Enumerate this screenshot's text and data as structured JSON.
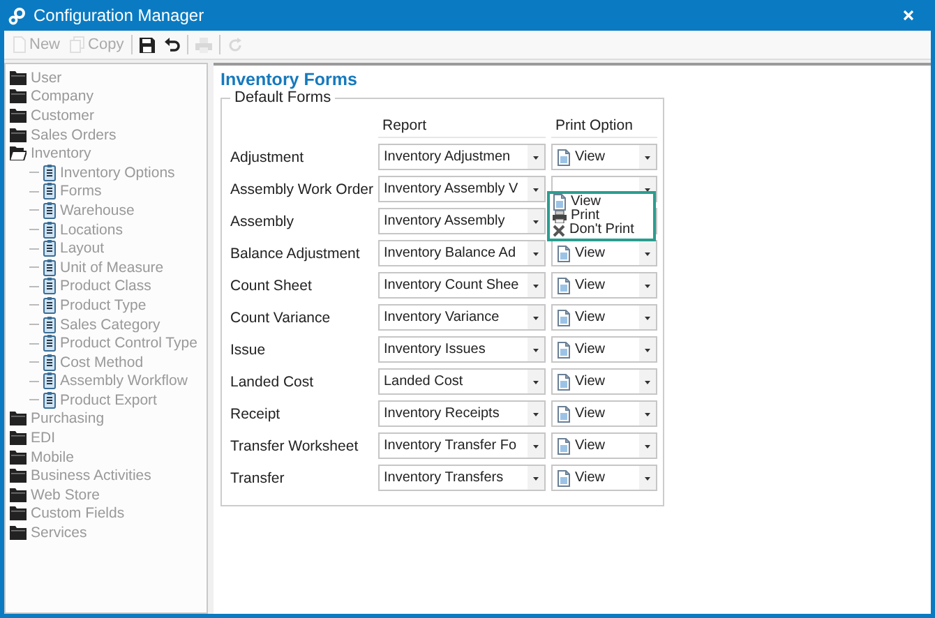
{
  "window": {
    "title": "Configuration Manager"
  },
  "toolbar": [
    {
      "kind": "new",
      "label": "New",
      "disabled": true
    },
    {
      "kind": "copy",
      "label": "Copy",
      "disabled": true
    },
    {
      "kind": "save",
      "disabled": false
    },
    {
      "kind": "undo",
      "disabled": false
    },
    {
      "kind": "print",
      "disabled": true
    },
    {
      "kind": "refresh",
      "disabled": true
    }
  ],
  "sidebar": {
    "items": [
      {
        "label": "User",
        "expanded": false
      },
      {
        "label": "Company",
        "expanded": false
      },
      {
        "label": "Customer",
        "expanded": false
      },
      {
        "label": "Sales Orders",
        "expanded": false
      },
      {
        "label": "Inventory",
        "expanded": true,
        "children": [
          {
            "label": "Inventory Options"
          },
          {
            "label": "Forms"
          },
          {
            "label": "Warehouse"
          },
          {
            "label": "Locations"
          },
          {
            "label": "Layout"
          },
          {
            "label": "Unit of Measure"
          },
          {
            "label": "Product Class"
          },
          {
            "label": "Product Type"
          },
          {
            "label": "Sales Category"
          },
          {
            "label": "Product Control Type"
          },
          {
            "label": "Cost Method"
          },
          {
            "label": "Assembly Workflow"
          },
          {
            "label": "Product Export"
          }
        ]
      },
      {
        "label": "Purchasing",
        "expanded": false
      },
      {
        "label": "EDI",
        "expanded": false
      },
      {
        "label": "Mobile",
        "expanded": false
      },
      {
        "label": "Business Activities",
        "expanded": false
      },
      {
        "label": "Web Store",
        "expanded": false
      },
      {
        "label": "Custom Fields",
        "expanded": false
      },
      {
        "label": "Services",
        "expanded": false
      }
    ]
  },
  "page": {
    "title": "Inventory Forms",
    "group": "Default Forms",
    "columns": [
      "Report",
      "Print Option"
    ],
    "rows": [
      {
        "label": "Adjustment",
        "report": "Inventory Adjustmen",
        "print_option": "View"
      },
      {
        "label": "Assembly Work Order",
        "report": "Inventory Assembly V"
      },
      {
        "label": "Assembly",
        "report": "Inventory Assembly"
      },
      {
        "label": "Balance Adjustment",
        "report": "Inventory Balance Ad",
        "print_option": "View"
      },
      {
        "label": "Count Sheet",
        "report": "Inventory Count Shee",
        "print_option": "View"
      },
      {
        "label": "Count Variance",
        "report": "Inventory Variance",
        "print_option": "View"
      },
      {
        "label": "Issue",
        "report": "Inventory Issues",
        "print_option": "View"
      },
      {
        "label": "Landed Cost",
        "report": "Landed Cost",
        "print_option": "View"
      },
      {
        "label": "Receipt",
        "report": "Inventory Receipts",
        "print_option": "View"
      },
      {
        "label": "Transfer Worksheet",
        "report": "Inventory Transfer Fo",
        "print_option": "View"
      },
      {
        "label": "Transfer",
        "report": "Inventory Transfers",
        "print_option": "View"
      }
    ],
    "dropdown": {
      "options": [
        {
          "kind": "view",
          "label": "View"
        },
        {
          "kind": "print",
          "label": "Print"
        },
        {
          "kind": "dont_print",
          "label": "Don't Print"
        }
      ]
    }
  }
}
